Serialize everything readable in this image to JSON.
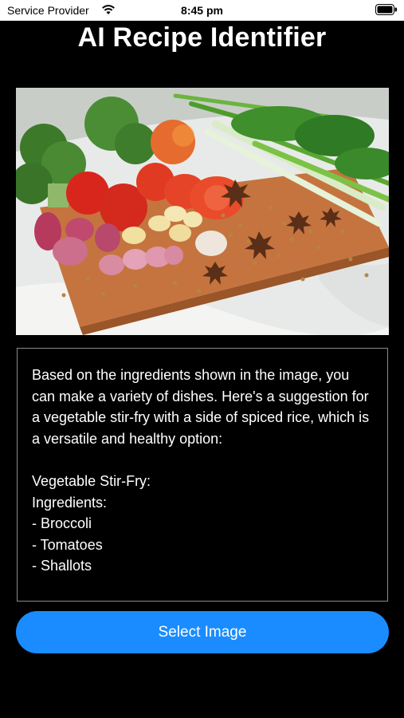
{
  "status_bar": {
    "carrier": "Service Provider",
    "time": "8:45 pm",
    "wifi_icon": "wifi-icon",
    "battery_icon": "battery-icon"
  },
  "app": {
    "title": "AI Recipe Identifier"
  },
  "image": {
    "subject": "Vegetables and spices on a wooden cutting board"
  },
  "result": {
    "text": "Based on the ingredients shown in the image, you can make a variety of dishes. Here's a suggestion for a vegetable stir-fry with a side of spiced rice, which is a versatile and healthy option:\n\nVegetable Stir-Fry:\nIngredients:\n- Broccoli\n- Tomatoes\n- Shallots"
  },
  "actions": {
    "select_image_label": "Select Image"
  },
  "colors": {
    "accent": "#1a8cff",
    "background": "#000000",
    "status_bar": "#ffffff"
  }
}
